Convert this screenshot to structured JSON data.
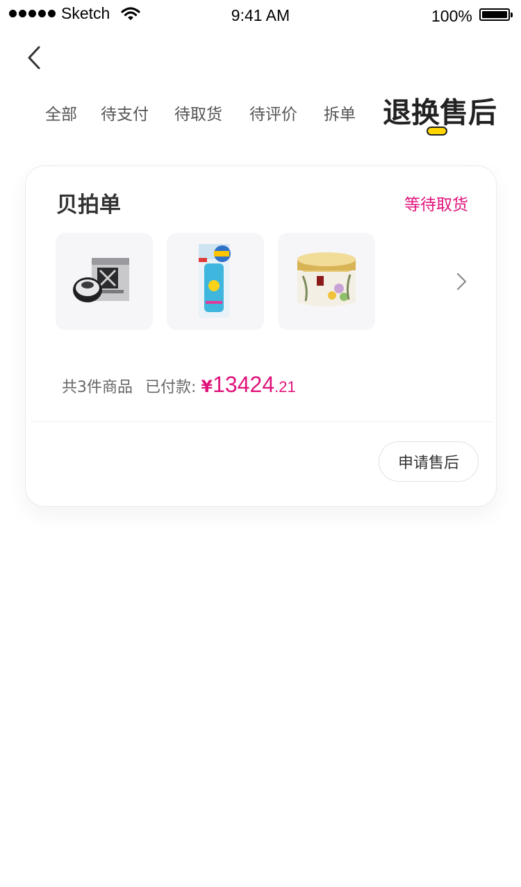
{
  "status_bar": {
    "carrier": "Sketch",
    "time": "9:41 AM",
    "battery": "100%"
  },
  "tabs": [
    {
      "label": "全部",
      "active": false
    },
    {
      "label": "待支付",
      "active": false
    },
    {
      "label": "待取货",
      "active": false
    },
    {
      "label": "待评价",
      "active": false
    },
    {
      "label": "拆单",
      "active": false
    },
    {
      "label": "退换售后",
      "active": true
    }
  ],
  "colors": {
    "accent": "#e0137b",
    "indicator": "#ffd500",
    "card_border": "#eaeaea",
    "thumb_bg": "#f6f6f8"
  },
  "order": {
    "type": "贝拍单",
    "status": "等待取货",
    "products": [
      {
        "icon": "eye-drops-product-icon"
      },
      {
        "icon": "sunscreen-product-icon"
      },
      {
        "icon": "cream-jar-product-icon"
      }
    ],
    "item_count_text": "共3件商品",
    "paid_label": "已付款:",
    "price_symbol": "¥",
    "price_integer": "13424",
    "price_decimal": ".21",
    "action_label": "申请售后"
  }
}
